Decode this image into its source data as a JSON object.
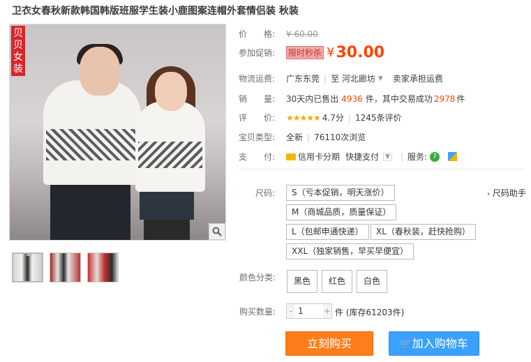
{
  "title": "卫衣女春秋新款韩国韩版班服学生装小鹿图案连帽外套情侣装 秋装",
  "brand_tag": "贝贝女装",
  "price": {
    "label": "价　　格:",
    "original": "¥ 60.00"
  },
  "promo": {
    "label": "参加促销:",
    "tag": "限时秒杀",
    "symbol": "¥",
    "price": "30.00"
  },
  "shipping": {
    "label": "物流运费:",
    "from": "广东东莞",
    "to": "至 河北廊坊",
    "fee": "卖家承担运费"
  },
  "sales": {
    "label": "销　　量:",
    "prefix": "30天内已售出",
    "sold": "4936",
    "mid": "件，其中交易成功",
    "success": "2978",
    "suffix": "件"
  },
  "rating": {
    "label": "评　　价:",
    "stars": "★★★★★",
    "score": "4.7分",
    "reviews": "1245条评价"
  },
  "item_type": {
    "label": "宝贝类型:",
    "condition": "全新",
    "views": "76110次浏览"
  },
  "payment": {
    "label": "支　　付:",
    "method1": "信用卡分期",
    "method2": "快捷支付",
    "service_label": "服务:"
  },
  "size": {
    "label": "尺码:",
    "help": "尺码助手",
    "options": [
      "S（亏本促销，明天涨价）",
      "M（商城品质，质量保证）",
      "L（包邮申通快递）",
      "XL（春秋装，赶快抢购）",
      "XXL（独家销售，早买早便宜）"
    ]
  },
  "color": {
    "label": "颜色分类:",
    "options": [
      "黑色",
      "红色",
      "白色"
    ]
  },
  "quantity": {
    "label": "购买数量:",
    "minus": "-",
    "value": "1",
    "plus": "+",
    "unit": "件 (库存61203件)"
  },
  "buttons": {
    "buy": "立刻购买",
    "cart": "加入购物车"
  },
  "colors": {
    "accent": "#ff4400",
    "buy_button": "#ff7d1a",
    "cart_button": "#3ba1ff"
  }
}
